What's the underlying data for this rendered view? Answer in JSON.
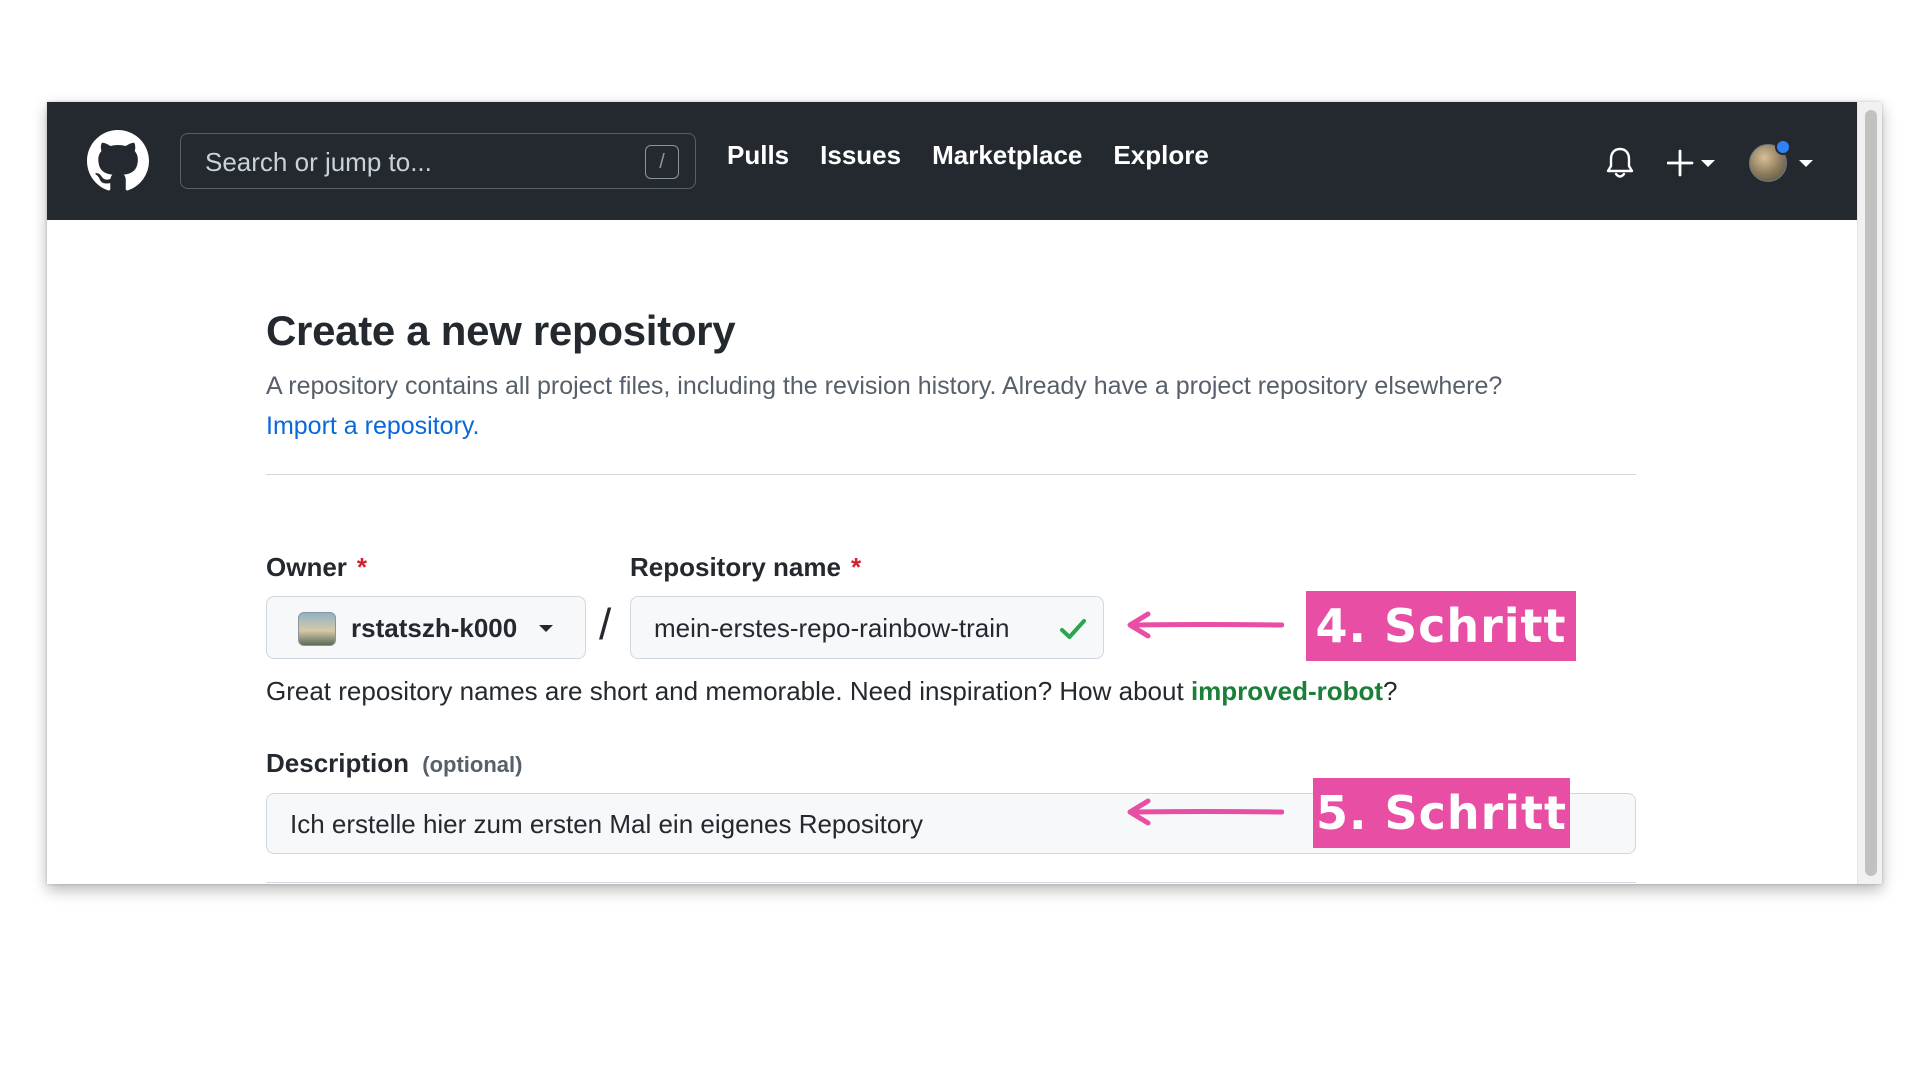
{
  "header": {
    "search_placeholder": "Search or jump to...",
    "search_shortcut": "/",
    "nav": [
      "Pulls",
      "Issues",
      "Marketplace",
      "Explore"
    ],
    "icons": [
      "github-logo-icon",
      "bell-icon",
      "plus-icon",
      "avatar"
    ]
  },
  "page": {
    "title": "Create a new repository",
    "intro_text": "A repository contains all project files, including the revision history. Already have a project repository elsewhere?",
    "import_link": "Import a repository."
  },
  "form": {
    "owner_label": "Owner",
    "required_mark": "*",
    "owner_value": "rstatszh-k000",
    "separator": "/",
    "repo_label": "Repository name",
    "repo_value": "mein-erstes-repo-rainbow-train",
    "hint_prefix": "Great repository names are short and memorable. Need inspiration? How about",
    "hint_suggestion": "improved-robot",
    "hint_suffix": "?",
    "description_label": "Description",
    "description_optional": "(optional)",
    "description_value": "Ich erstelle hier zum ersten Mal ein eigenes Repository"
  },
  "annotations": {
    "step4": "4. Schritt",
    "step5": "5. Schritt",
    "color": "#e84ea3"
  },
  "colors": {
    "header_bg": "#24292f",
    "link": "#0969da",
    "success": "#1a7f37",
    "required": "#cf222e"
  }
}
